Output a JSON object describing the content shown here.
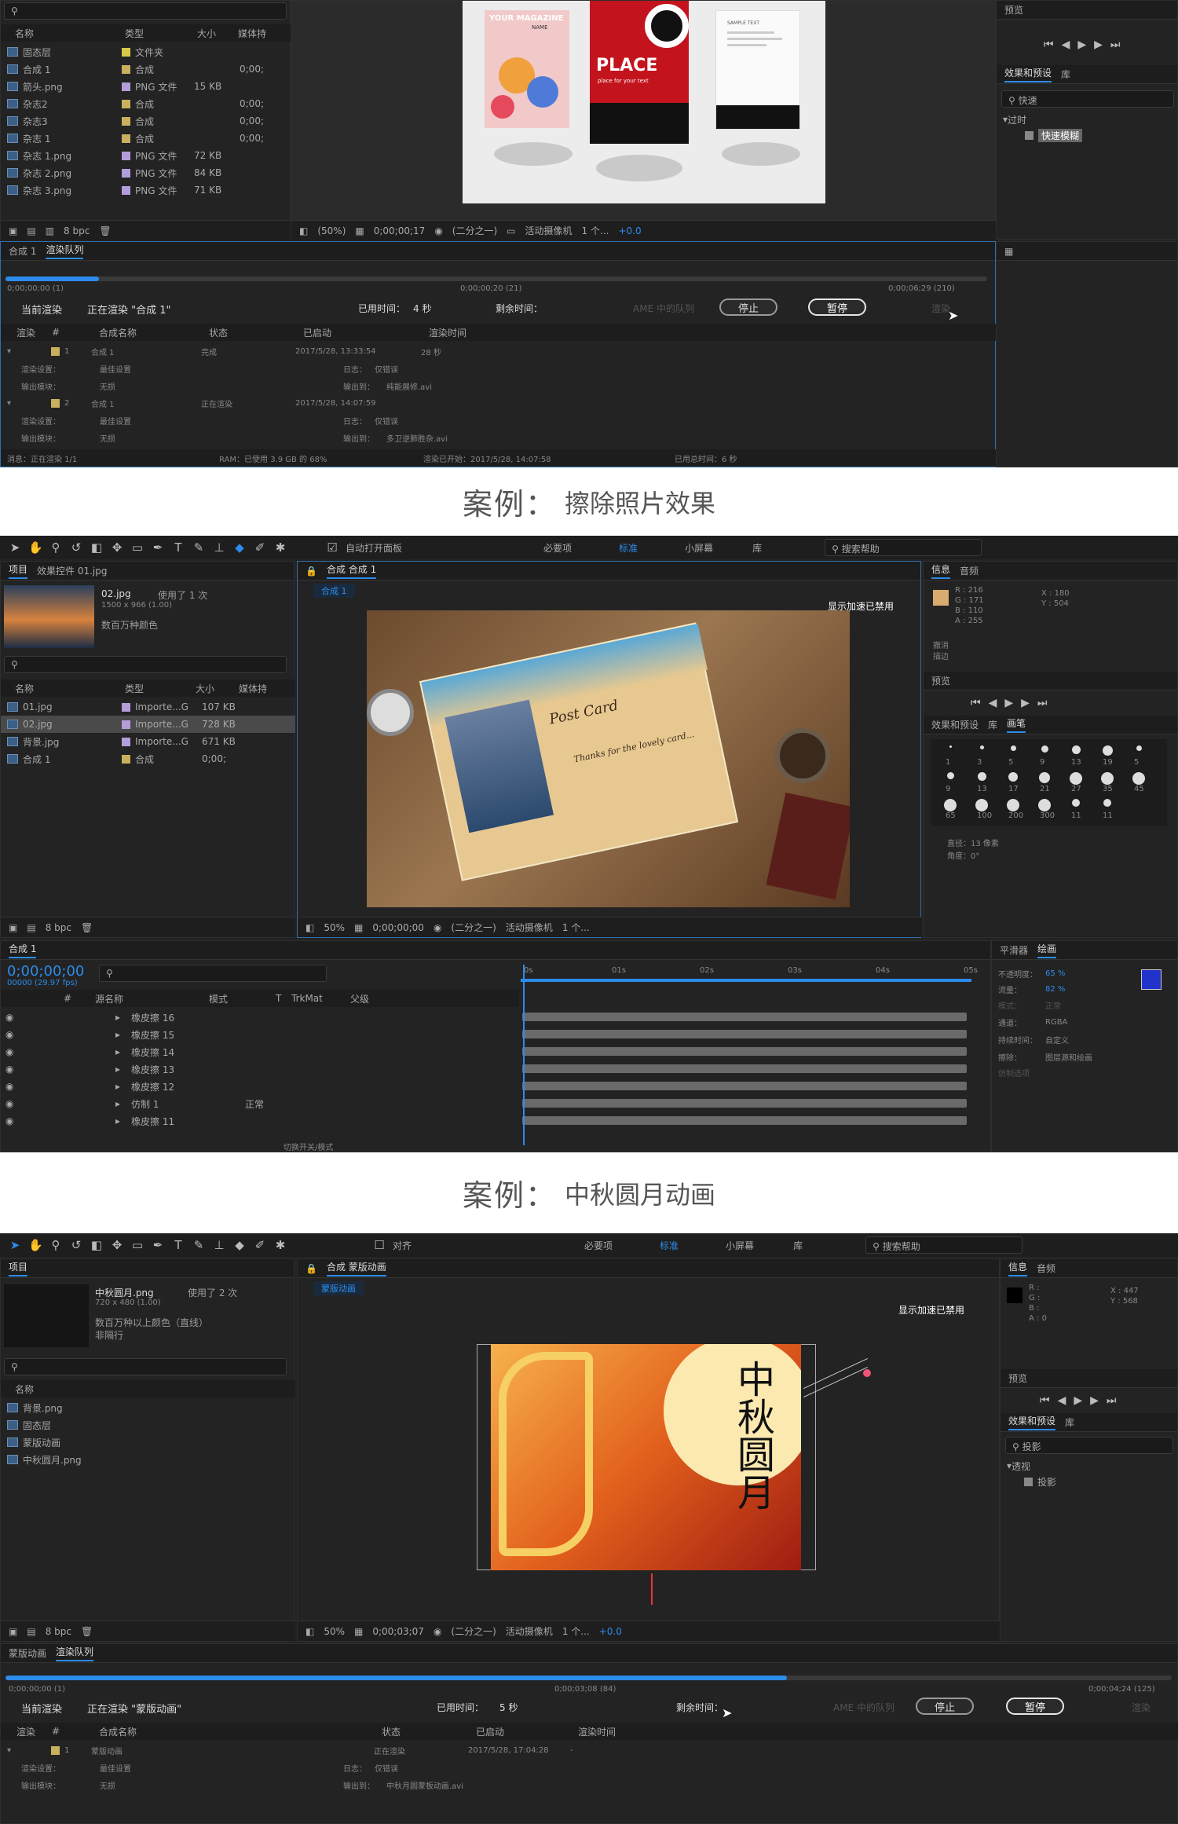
{
  "section1": {
    "project_panel": {
      "columns": [
        "名称",
        "类型",
        "大小",
        "媒体持"
      ],
      "items": [
        {
          "name": "固态层",
          "type": "文件夹",
          "size": "",
          "dur": "",
          "color": "#d8c84b",
          "icon": "folder-icon"
        },
        {
          "name": "合成 1",
          "type": "合成",
          "size": "",
          "dur": "0;00;",
          "color": "#c8b05e",
          "icon": "composition-icon"
        },
        {
          "name": "箭头.png",
          "type": "PNG 文件",
          "size": "15 KB",
          "dur": "",
          "color": "#b39ddb",
          "icon": "image-file-icon"
        },
        {
          "name": "杂志2",
          "type": "合成",
          "size": "",
          "dur": "0;00;",
          "color": "#c8b05e",
          "icon": "composition-icon"
        },
        {
          "name": "杂志3",
          "type": "合成",
          "size": "",
          "dur": "0;00;",
          "color": "#c8b05e",
          "icon": "composition-icon"
        },
        {
          "name": "杂志 1",
          "type": "合成",
          "size": "",
          "dur": "0;00;",
          "color": "#c8b05e",
          "icon": "composition-icon"
        },
        {
          "name": "杂志 1.png",
          "type": "PNG 文件",
          "size": "72 KB",
          "dur": "",
          "color": "#b39ddb",
          "icon": "image-file-icon"
        },
        {
          "name": "杂志 2.png",
          "type": "PNG 文件",
          "size": "84 KB",
          "dur": "",
          "color": "#b39ddb",
          "icon": "image-file-icon"
        },
        {
          "name": "杂志 3.png",
          "type": "PNG 文件",
          "size": "71 KB",
          "dur": "",
          "color": "#b39ddb",
          "icon": "image-file-icon"
        }
      ],
      "bpc": "8 bpc"
    },
    "viewer": {
      "zoom": "(50%)",
      "time": "0;00;00;17",
      "resolution": "(二分之一)",
      "camera": "活动摄像机",
      "views": "1 个...",
      "exposure": "+0.0",
      "cards": [
        {
          "title": "YOUR MAGAZINE",
          "sub": "NAME"
        },
        {
          "title": "PLACE",
          "sub": "place for your text"
        },
        {
          "title": "SAMPLE TEXT",
          "sub": ""
        }
      ]
    },
    "right_panels": {
      "preview_label": "预览",
      "effects_tab": "效果和预设",
      "library_tab": "库",
      "search": "快速",
      "group": "过时",
      "effect": "快速模糊"
    },
    "render_queue": {
      "tabs": [
        "合成 1",
        "渲染队列"
      ],
      "time_start": "0;00;00;00 (1)",
      "time_mid": "0;00;00;20 (21)",
      "time_end": "0;00;06;29 (210)",
      "current_label": "当前渲染",
      "current_value": "正在渲染 \"合成 1\"",
      "elapsed_label": "已用时间：",
      "elapsed_value": "4 秒",
      "remaining_label": "剩余时间：",
      "queue_label": "AME 中的队列",
      "stop": "停止",
      "pause": "暂停",
      "render": "渲染",
      "progress": 0.095,
      "columns": [
        "渲染",
        "#",
        "合成名称",
        "状态",
        "已启动",
        "渲染时间"
      ],
      "rows": [
        {
          "num": "1",
          "name": "合成 1",
          "status": "完成",
          "started": "2017/5/28, 13:33:54",
          "time": "28 秒"
        },
        {
          "num": "2",
          "name": "合成 1",
          "status": "正在渲染",
          "started": "2017/5/28, 14:07:59",
          "time": ""
        }
      ],
      "settings_label": "渲染设置：",
      "settings_value": "最佳设置",
      "log_label": "日志：",
      "log_value": "仅错误",
      "module_label": "输出模块：",
      "module_value": "无损",
      "output_label": "输出到：",
      "output_value_1": "纯能展修.avi",
      "output_value_2": "多卫逆肺胜杂.avi",
      "status_bar": {
        "msg": "消息：正在渲染 1/1",
        "ram": "RAM：已使用 3.9 GB 的 68%",
        "started": "渲染已开始：2017/5/28, 14:07:58",
        "total": "已用总时间：6 秒"
      }
    }
  },
  "caption1": {
    "label": "案例：",
    "text": "擦除照片效果"
  },
  "section2": {
    "toolbar": {
      "auto_open": "自动打开面板",
      "ws1": "必要项",
      "ws2": "标准",
      "ws3": "小屏幕",
      "ws4": "库",
      "search": "搜索帮助"
    },
    "project_panel": {
      "tabs": [
        "项目",
        "效果控件 01.jpg"
      ],
      "selected": "02.jpg",
      "used": "使用了 1 次",
      "dims": "1500 x 966 (1.00)",
      "colors": "数百万种颜色",
      "columns": [
        "名称",
        "类型",
        "大小",
        "媒体持"
      ],
      "items": [
        {
          "name": "01.jpg",
          "type": "Importe...G",
          "size": "107 KB",
          "color": "#b39ddb"
        },
        {
          "name": "02.jpg",
          "type": "Importe...G",
          "size": "728 KB",
          "color": "#b39ddb"
        },
        {
          "name": "背景.jpg",
          "type": "Importe...G",
          "size": "671 KB",
          "color": "#b39ddb"
        },
        {
          "name": "合成 1",
          "type": "合成",
          "size": "0;00;",
          "color": "#c8b05e"
        }
      ],
      "bpc": "8 bpc"
    },
    "comp_panel": {
      "tab": "合成 合成 1",
      "breadcrumb": "合成 1",
      "accel": "显示加速已禁用",
      "postcard_title": "Post Card",
      "postcard_script": "Thanks for the lovely card...",
      "zoom": "50%",
      "time": "0;00;00;00",
      "resolution": "(二分之一)",
      "camera": "活动摄像机",
      "views": "1 个..."
    },
    "info_panel": {
      "tabs": [
        "信息",
        "音频"
      ],
      "r": "R : 216",
      "g": "G : 171",
      "b": "B : 110",
      "a": "A : 255",
      "x": "X : 180",
      "y": "Y : 504",
      "undo": "撤消",
      "undo2": "描边",
      "preview": "预览",
      "effects": "效果和预设",
      "library": "库",
      "brush_tab": "画笔",
      "brush_sizes": [
        "1",
        "3",
        "5",
        "9",
        "13",
        "19",
        "5",
        "9",
        "13",
        "17",
        "21",
        "27",
        "35",
        "45",
        "65",
        "100",
        "200",
        "300",
        "11",
        "11"
      ],
      "diameter": "直径：13 像素",
      "angle": "角度：0°"
    },
    "timeline": {
      "tab": "合成 1",
      "timecode": "0;00;00;00",
      "fps": "00000 (29.97 fps)",
      "columns": [
        "#",
        "源名称",
        "模式",
        "T",
        "TrkMat",
        "父级"
      ],
      "layers": [
        {
          "name": "橡皮擦 16",
          "mode": ""
        },
        {
          "name": "橡皮擦 15",
          "mode": ""
        },
        {
          "name": "橡皮擦 14",
          "mode": ""
        },
        {
          "name": "橡皮擦 13",
          "mode": ""
        },
        {
          "name": "橡皮擦 12",
          "mode": ""
        },
        {
          "name": "仿制 1",
          "mode": "正常"
        },
        {
          "name": "橡皮擦 11",
          "mode": ""
        }
      ],
      "ticks": [
        "0s",
        "01s",
        "02s",
        "03s",
        "04s",
        "05s"
      ],
      "switches": "切换开关/模式"
    },
    "paint_panel": {
      "tabs": [
        "平滑器",
        "绘画"
      ],
      "opacity_label": "不透明度：",
      "opacity": "65 %",
      "flow_label": "流量：",
      "flow": "82 %",
      "mode_label": "模式：",
      "mode": "正常",
      "channel_label": "通道：",
      "channel": "RGBA",
      "duration_label": "持续时间：",
      "duration": "自定义",
      "erase_label": "擦除：",
      "erase": "图层源和绘画",
      "clone": "仿制选项",
      "fg_color": "#2233cc"
    }
  },
  "caption2": {
    "label": "案例：",
    "text": "中秋圆月动画"
  },
  "section3": {
    "toolbar": {
      "align": "对齐",
      "ws1": "必要项",
      "ws2": "标准",
      "ws3": "小屏幕",
      "ws4": "库",
      "search": "搜索帮助"
    },
    "project_panel": {
      "tab": "项目",
      "selected": "中秋圆月.png",
      "used": "使用了 2 次",
      "dims": "720 x 480 (1.00)",
      "colors": "数百万种以上颜色（直线）",
      "colors2": "非隔行",
      "columns": [
        "名称"
      ],
      "items": [
        {
          "name": "背景.png",
          "color": "#b39ddb",
          "icon": "image-file-icon"
        },
        {
          "name": "固态层",
          "color": "#d8c84b",
          "icon": "folder-icon"
        },
        {
          "name": "蒙版动画",
          "color": "#c8b05e",
          "icon": "composition-icon"
        },
        {
          "name": "中秋圆月.png",
          "color": "#b39ddb",
          "icon": "image-file-icon"
        }
      ],
      "bpc": "8 bpc"
    },
    "comp_panel": {
      "tab": "合成 蒙版动画",
      "breadcrumb": "蒙版动画",
      "accel": "显示加速已禁用",
      "calligraphy": "中秋圆月",
      "zoom": "50%",
      "time": "0;00;03;07",
      "resolution": "(二分之一)",
      "camera": "活动摄像机",
      "views": "1 个...",
      "exposure": "+0.0"
    },
    "info_panel": {
      "tabs": [
        "信息",
        "音频"
      ],
      "r": "R :",
      "g": "G :",
      "b": "B :",
      "a": "A : 0",
      "x": "X : 447",
      "y": "Y : 568",
      "preview": "预览",
      "effects": "效果和预设",
      "library": "库",
      "search": "投影",
      "group": "透视",
      "effect": "投影"
    },
    "render_queue": {
      "tabs": [
        "蒙版动画",
        "渲染队列"
      ],
      "time_start": "0;00;00;00 (1)",
      "time_mid": "0;00;03;08 (84)",
      "time_end": "0;00;04;24 (125)",
      "current_label": "当前渲染",
      "current_value": "正在渲染 \"蒙版动画\"",
      "elapsed_label": "已用时间：",
      "elapsed_value": "5 秒",
      "remaining_label": "剩余时间：",
      "queue_label": "AME 中的队列",
      "stop": "停止",
      "pause": "暂停",
      "render": "渲染",
      "progress": 0.67,
      "columns": [
        "渲染",
        "#",
        "合成名称",
        "状态",
        "已启动",
        "渲染时间"
      ],
      "row": {
        "num": "1",
        "name": "蒙版动画",
        "status": "正在渲染",
        "started": "2017/5/28, 17:04:28",
        "time": "-"
      },
      "settings_label": "渲染设置：",
      "settings_value": "最佳设置",
      "log_label": "日志：",
      "log_value": "仅错误",
      "module_label": "输出模块：",
      "module_value": "无损",
      "output_label": "输出到：",
      "output_value": "中秋月圆蒙板动画.avi"
    }
  }
}
